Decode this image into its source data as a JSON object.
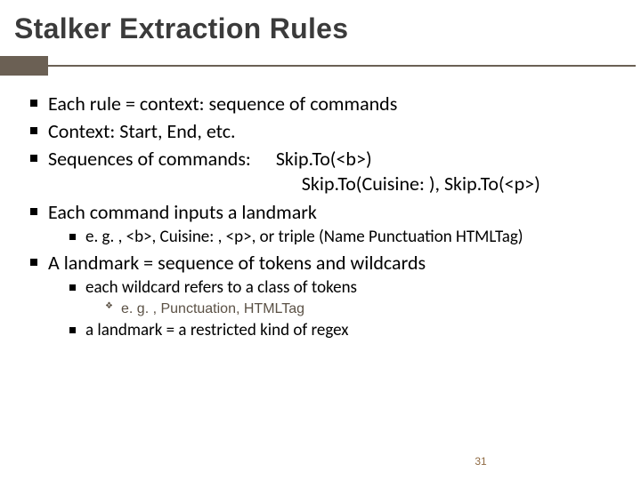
{
  "title": "Stalker Extraction Rules",
  "bullets": {
    "b1": "Each rule = context: sequence of commands",
    "b2": "Context: Start, End, etc.",
    "b3_label": "Sequences of commands:",
    "b3_code1": "Skip.To(<b>)",
    "b3_code2": "Skip.To(Cuisine: ), Skip.To(<p>)",
    "b4": "Each command inputs a landmark",
    "b4_sub1": "e. g. , <b>, Cuisine: , <p>, or triple (Name Punctuation HTMLTag)",
    "b5": "A landmark = sequence of tokens and wildcards",
    "b5_sub1": "each wildcard refers to a class of tokens",
    "b5_sub1_sub": "e. g. , Punctuation, HTMLTag",
    "b5_sub2": "a landmark = a restricted kind of regex"
  },
  "page_number": "31"
}
